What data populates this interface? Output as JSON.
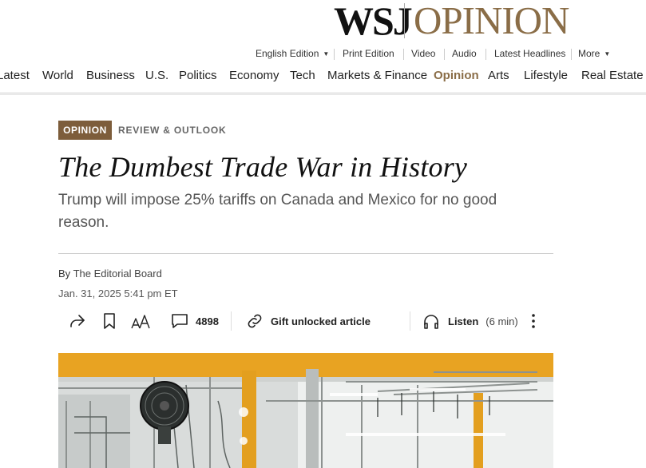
{
  "masthead": {
    "brand": "WSJ",
    "section": "OPINION"
  },
  "utility": {
    "edition": "English Edition",
    "items": [
      "Print Edition",
      "Video",
      "Audio",
      "Latest Headlines"
    ],
    "more": "More"
  },
  "nav": {
    "items": [
      "Latest",
      "World",
      "Business",
      "U.S.",
      "Politics",
      "Economy",
      "Tech",
      "Markets & Finance",
      "Opinion",
      "Arts",
      "Lifestyle",
      "Real Estate"
    ],
    "active": "Opinion"
  },
  "article": {
    "badge": "OPINION",
    "flash": "REVIEW & OUTLOOK",
    "headline": "The Dumbest Trade War in History",
    "dek": "Trump will impose 25% tariffs on Canada and Mexico for no good reason.",
    "byline_prefix": "By",
    "author": "The Editorial Board",
    "timestamp": "Jan. 31, 2025 5:41 pm ET"
  },
  "tools": {
    "comment_count": "4898",
    "gift_label": "Gift unlocked article",
    "listen_label": "Listen",
    "listen_duration": "(6 min)"
  },
  "icons": [
    "share-icon",
    "bookmark-icon",
    "text-size-icon",
    "comment-icon",
    "link-icon",
    "headphones-icon",
    "more-vertical-icon",
    "chevron-down-icon"
  ],
  "colors": {
    "opinion_brown": "#7d5d3b",
    "opinion_mast": "#8a6d47",
    "hero_yellow": "#e8a322"
  }
}
